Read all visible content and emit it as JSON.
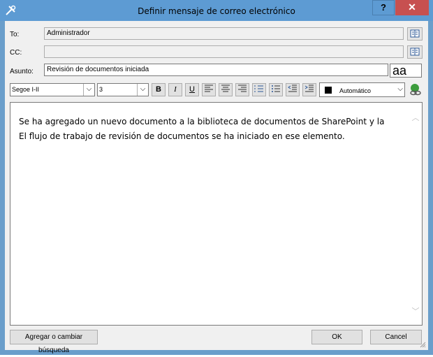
{
  "window": {
    "title": "Definir mensaje de correo electrónico",
    "help_label": "?",
    "close_label": "✕",
    "app_icon": "tools-icon"
  },
  "fields": {
    "to_label": "To:",
    "to_value": "Administrador",
    "cc_label": "CC:",
    "cc_value": "",
    "subject_label": "Asunto:",
    "subject_value": "Revisión de documentos iniciada",
    "address_book_icon": "address-book-icon",
    "font_preview": "aa"
  },
  "toolbar": {
    "font_name": "Segoe I-II",
    "font_size": "3",
    "bold": "B",
    "italic": "I",
    "underline": "U",
    "align_left_icon": "align-left-icon",
    "align_center_icon": "align-center-icon",
    "align_right_icon": "align-right-icon",
    "numbered_list_icon": "numbered-list-icon",
    "bulleted_list_icon": "bulleted-list-icon",
    "outdent_icon": "outdent-icon",
    "indent_icon": "indent-icon",
    "color_label": "Automático",
    "color_value": "#000000",
    "hyperlink_icon": "hyperlink-icon"
  },
  "body": {
    "line1": "Se ha agregado un nuevo documento a la biblioteca de documentos de SharePoint y la",
    "line2": "El flujo de trabajo de revisión de documentos se ha iniciado en ese elemento."
  },
  "buttons": {
    "lookup": "Agregar o cambiar búsqueda",
    "ok": "OK",
    "cancel": "Cancel"
  }
}
